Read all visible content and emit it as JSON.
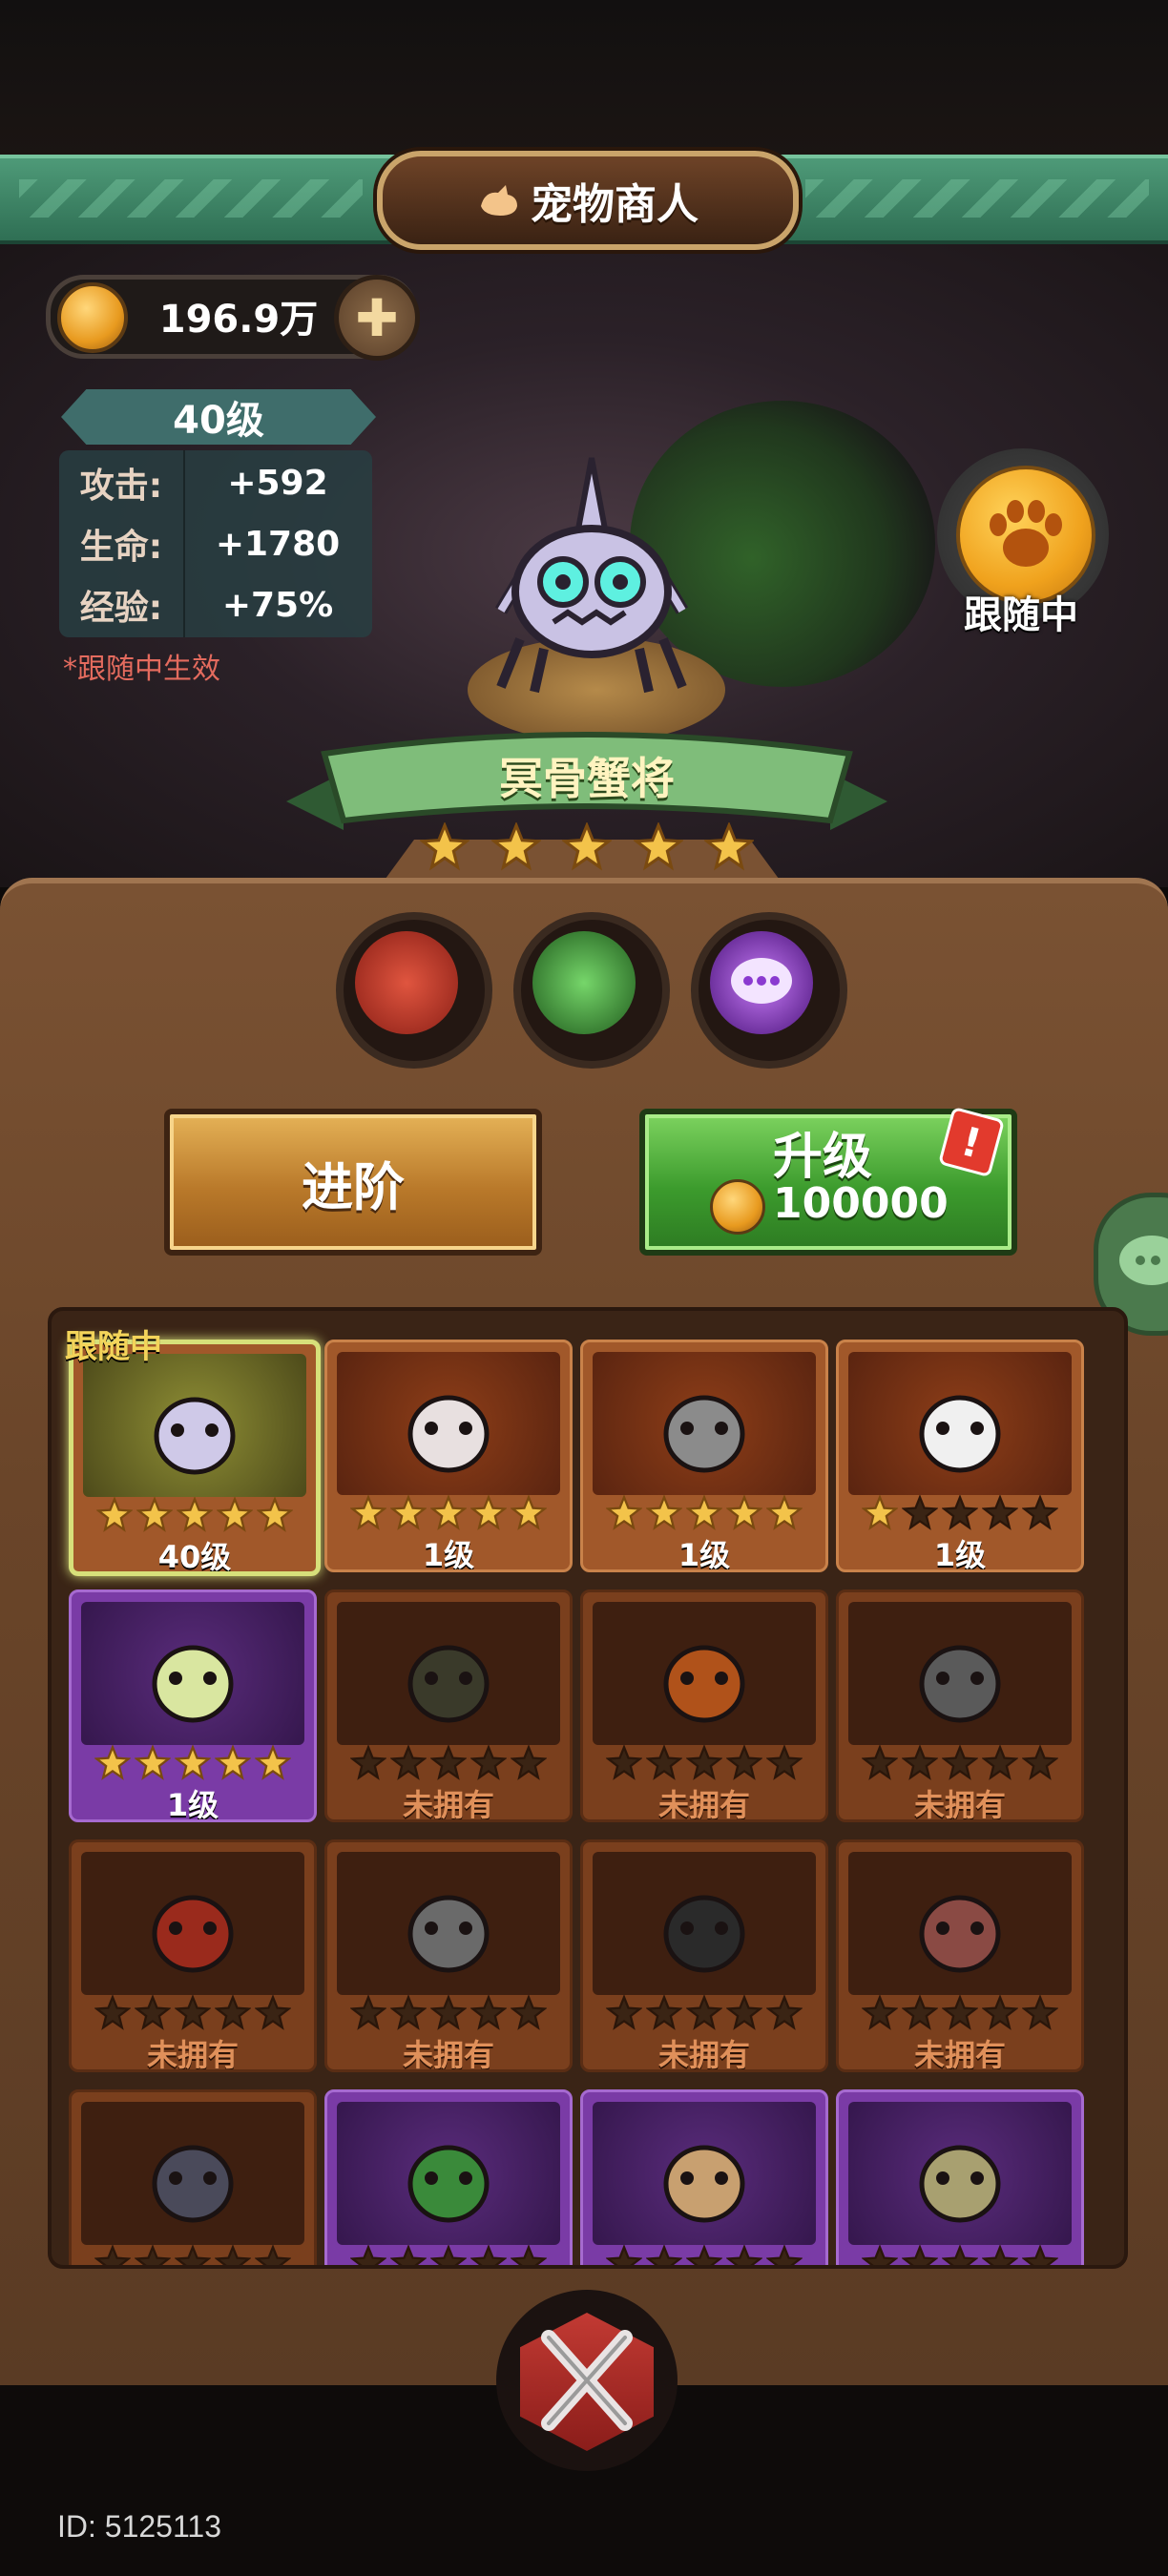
{
  "header": {
    "title": "宠物商人"
  },
  "currency": {
    "value": "196.9万",
    "add_symbol": "✚"
  },
  "pet_stats": {
    "level": "40级",
    "rows": [
      {
        "label": "攻击:",
        "value": "+592"
      },
      {
        "label": "生命:",
        "value": "+1780"
      },
      {
        "label": "经验:",
        "value": "+75%"
      }
    ],
    "note": "*跟随中生效"
  },
  "follow_button": {
    "label": "跟随中"
  },
  "selected_pet": {
    "name": "冥骨蟹将",
    "stars": 5
  },
  "skills": [
    {
      "name": "fist-skill-icon",
      "color": "#b83a2a"
    },
    {
      "name": "claw-skill-icon",
      "color": "#3f9c3a"
    },
    {
      "name": "chat-bubble-skill-icon",
      "color": "#8a3ad0"
    }
  ],
  "actions": {
    "advance_label": "进阶",
    "upgrade_label": "升级",
    "upgrade_cost": "100000",
    "alert": "!"
  },
  "grid": {
    "follow_tag": "跟随中",
    "cards": [
      {
        "style": "selected",
        "stars": 5,
        "level": "40级",
        "pet": "bone-crab-pet",
        "color": "#cfc9e8"
      },
      {
        "style": "orange",
        "stars": 5,
        "level": "1级",
        "pet": "clown-bird-pet",
        "color": "#e8e0e0"
      },
      {
        "style": "orange",
        "stars": 5,
        "level": "1级",
        "pet": "diver-pig-pet",
        "color": "#8b8b8b"
      },
      {
        "style": "orange",
        "stars": 1,
        "level": "1级",
        "pet": "straw-hat-duck-pet",
        "color": "#f0f0f0"
      },
      {
        "style": "purple",
        "stars": 5,
        "level": "1级",
        "pet": "owl-spirit-pet",
        "color": "#d9e6a0"
      },
      {
        "style": "dim",
        "stars": 0,
        "level": "未拥有",
        "pet": "mimic-chest-pet",
        "color": "#3a3a2a"
      },
      {
        "style": "dim",
        "stars": 0,
        "level": "未拥有",
        "pet": "fire-dragon-pet",
        "color": "#b0521a"
      },
      {
        "style": "dim",
        "stars": 0,
        "level": "未拥有",
        "pet": "knight-helmet-pet",
        "color": "#5a5a5a"
      },
      {
        "style": "dim",
        "stars": 0,
        "level": "未拥有",
        "pet": "daruma-pet",
        "color": "#9a2a1c"
      },
      {
        "style": "dim",
        "stars": 0,
        "level": "未拥有",
        "pet": "gauntlet-pet",
        "color": "#6a6a6a"
      },
      {
        "style": "dim",
        "stars": 0,
        "level": "未拥有",
        "pet": "crow-reaper-pet",
        "color": "#2a2a2a"
      },
      {
        "style": "dim",
        "stars": 0,
        "level": "未拥有",
        "pet": "teddy-bear-pet",
        "color": "#8a4a44"
      },
      {
        "style": "dim",
        "stars": 0,
        "level": "",
        "pet": "gray-cat-pet",
        "color": "#4a4a5a"
      },
      {
        "style": "purple",
        "stars": 0,
        "level": "",
        "pet": "green-frog-pet",
        "color": "#3a8a3a"
      },
      {
        "style": "purple",
        "stars": 0,
        "level": "",
        "pet": "rooster-pet",
        "color": "#c8a070"
      },
      {
        "style": "purple",
        "stars": 0,
        "level": "",
        "pet": "zombie-chick-pet",
        "color": "#a8a070"
      }
    ]
  },
  "footer": {
    "user_id": "ID: 5125113"
  }
}
